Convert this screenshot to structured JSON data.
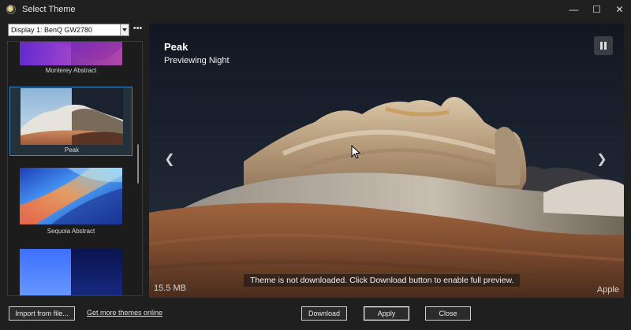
{
  "window": {
    "title": "Select Theme"
  },
  "display": {
    "selected": "Display 1: BenQ GW2780"
  },
  "themes": [
    {
      "label": "Monterey Abstract"
    },
    {
      "label": "Peak"
    },
    {
      "label": "Sequoia Abstract"
    },
    {
      "label": ""
    }
  ],
  "preview": {
    "title": "Peak",
    "subtitle": "Previewing Night",
    "size": "15.5 MB",
    "notice": "Theme is not downloaded. Click Download button to enable full preview.",
    "credit": "Apple"
  },
  "footer": {
    "import_label": "Import from file...",
    "more_link": "Get more themes online",
    "download_label": "Download",
    "apply_label": "Apply",
    "close_label": "Close"
  },
  "colors": {
    "selection": "#3b87c8",
    "background": "#1f1f1f"
  }
}
